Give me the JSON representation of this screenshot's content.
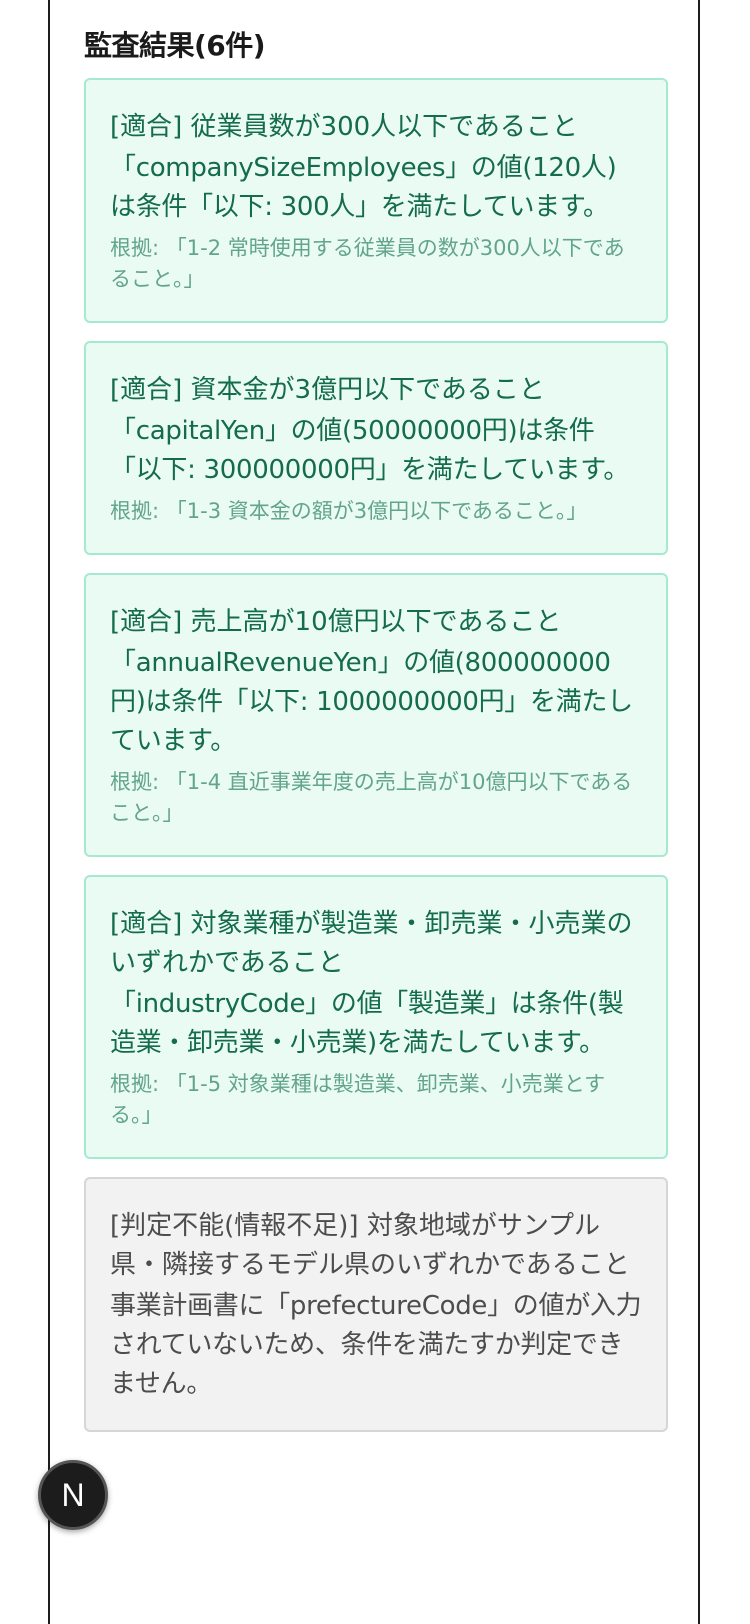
{
  "section": {
    "title": "監査結果(6件)"
  },
  "results": [
    {
      "status": "pass",
      "title": "[適合] 従業員数が300人以下であること",
      "message": "「companySizeEmployees」の値(120人)は条件「以下: 300人」を満たしています。",
      "basis": "根拠: 「1-2 常時使用する従業員の数が300人以下であること。」"
    },
    {
      "status": "pass",
      "title": "[適合] 資本金が3億円以下であること",
      "message": "「capitalYen」の値(50000000円)は条件「以下: 300000000円」を満たしています。",
      "basis": "根拠: 「1-3 資本金の額が3億円以下であること。」"
    },
    {
      "status": "pass",
      "title": "[適合] 売上高が10億円以下であること",
      "message": "「annualRevenueYen」の値(800000000円)は条件「以下: 1000000000円」を満たしています。",
      "basis": "根拠: 「1-4 直近事業年度の売上高が10億円以下であること。」"
    },
    {
      "status": "pass",
      "title": "[適合] 対象業種が製造業・卸売業・小売業のいずれかであること",
      "message": "「industryCode」の値「製造業」は条件(製造業・卸売業・小売業)を満たしています。",
      "basis": "根拠: 「1-5 対象業種は製造業、卸売業、小売業とする。」"
    },
    {
      "status": "unknown",
      "title": "[判定不能(情報不足)] 対象地域がサンプル県・隣接するモデル県のいずれかであること",
      "message": "事業計画書に「prefectureCode」の値が入力されていないため、条件を満たすか判定できません。",
      "basis": ""
    }
  ],
  "fab": {
    "label": "N"
  },
  "colors": {
    "pass_border": "#a5ead0",
    "pass_background": "#eafbf3",
    "pass_text": "#146c4a",
    "unknown_border": "#d6d6d6",
    "unknown_background": "#f2f2f2",
    "unknown_text": "#4d4d4d"
  }
}
